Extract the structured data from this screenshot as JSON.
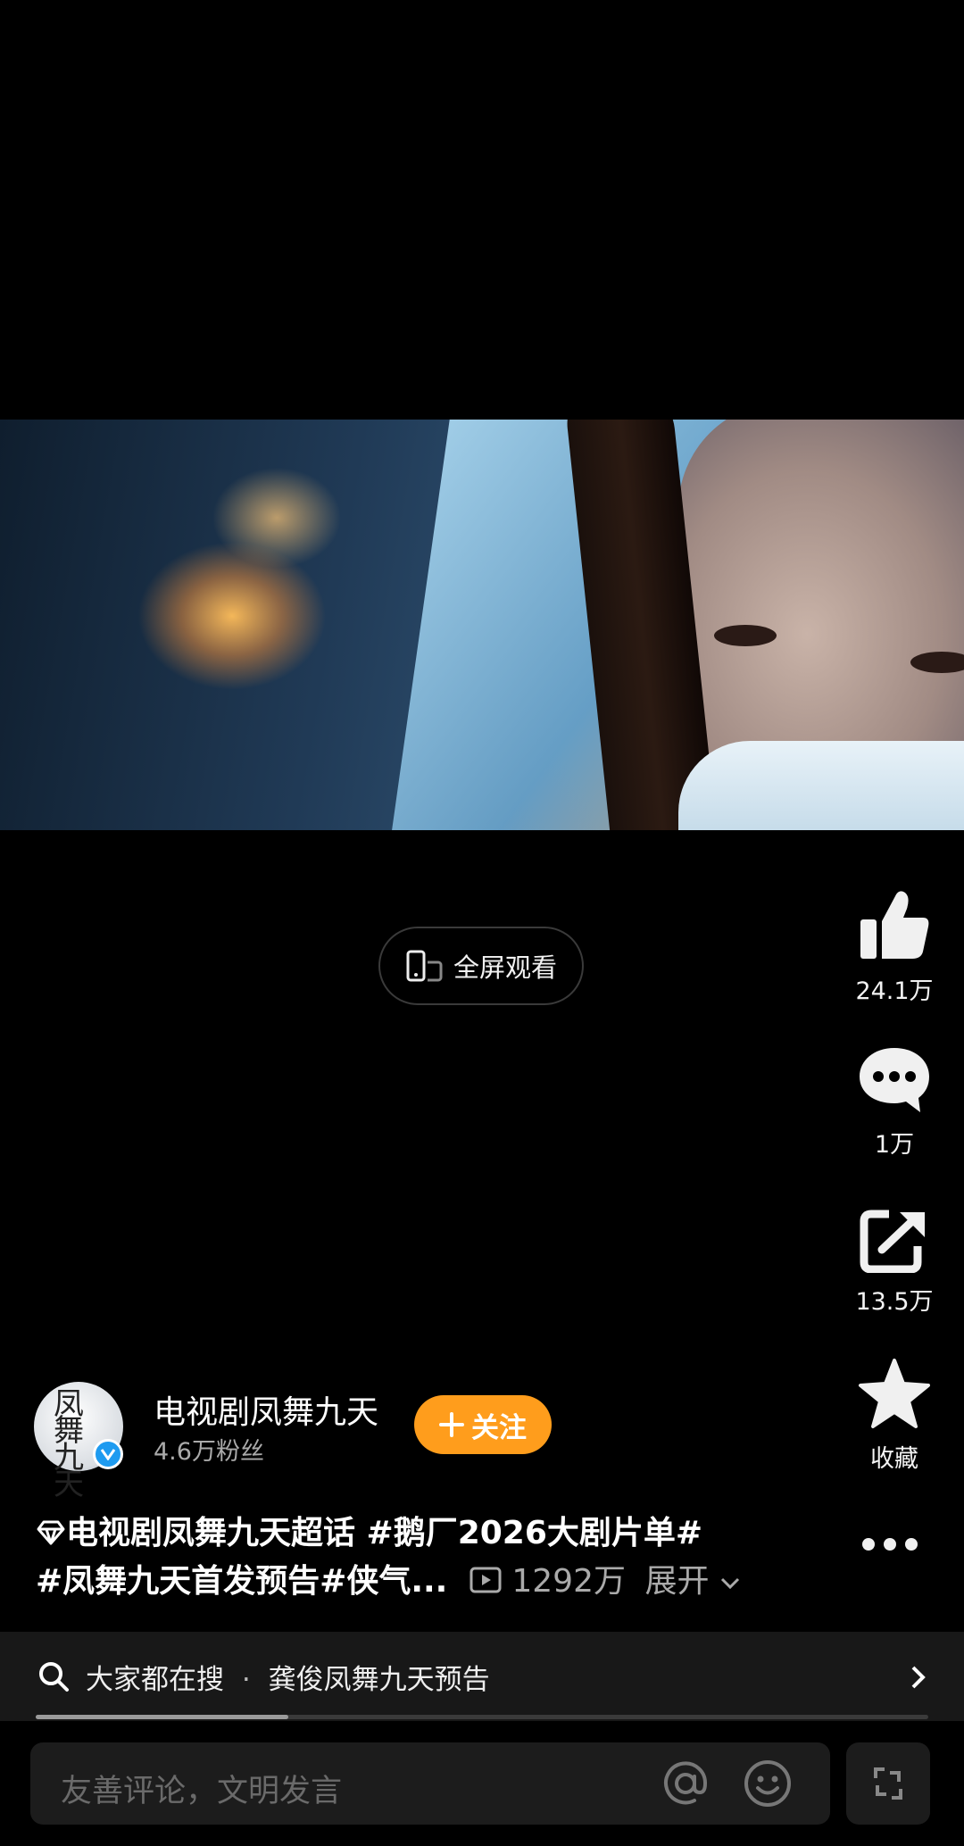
{
  "fullscreen": {
    "label": "全屏观看"
  },
  "actions": {
    "like_count": "24.1万",
    "comment_count": "1万",
    "share_count": "13.5万",
    "favorite_label": "收藏"
  },
  "author": {
    "name": "电视剧凤舞九天",
    "followers": "4.6万粉丝",
    "follow_label": "关注",
    "avatar_text": "凤舞九天"
  },
  "caption": {
    "line1": "电视剧凤舞九天超话  #鹅厂2026大剧片单#",
    "line2": "#凤舞九天首发预告#侠气...",
    "play_count": "1292万",
    "expand_label": "展开"
  },
  "search": {
    "prefix": "大家都在搜",
    "query": "龚俊凤舞九天预告",
    "progress": 0.283
  },
  "comment": {
    "placeholder": "友善评论，文明发言"
  },
  "colors": {
    "follow": "#ff9d1c",
    "verified": "#1e9bf0",
    "background": "#000000"
  }
}
